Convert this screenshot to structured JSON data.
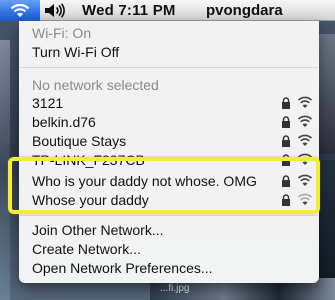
{
  "menubar": {
    "clock": "Wed 7:11 PM",
    "username": "pvongdara"
  },
  "wifi_menu": {
    "status": "Wi-Fi: On",
    "toggle": "Turn Wi-Fi Off",
    "no_network": "No network selected",
    "networks": [
      {
        "name": "3121",
        "secured": true,
        "signal_bars": 3
      },
      {
        "name": "belkin.d76",
        "secured": true,
        "signal_bars": 3
      },
      {
        "name": "Boutique Stays",
        "secured": true,
        "signal_bars": 3
      },
      {
        "name": "TP-LINK_F237CB",
        "secured": true,
        "signal_bars": 3
      },
      {
        "name": "Who is your daddy not whose. OMG",
        "secured": true,
        "signal_bars": 3
      },
      {
        "name": "Whose your daddy",
        "secured": true,
        "signal_bars": 2
      }
    ],
    "join_other": "Join Other Network...",
    "create": "Create Network...",
    "preferences": "Open Network Preferences..."
  },
  "desktop": {
    "filename": "...fi.jpg"
  },
  "colors": {
    "menubar_highlight": "#2f70e0",
    "annotation_highlight": "#f5ec3a"
  }
}
